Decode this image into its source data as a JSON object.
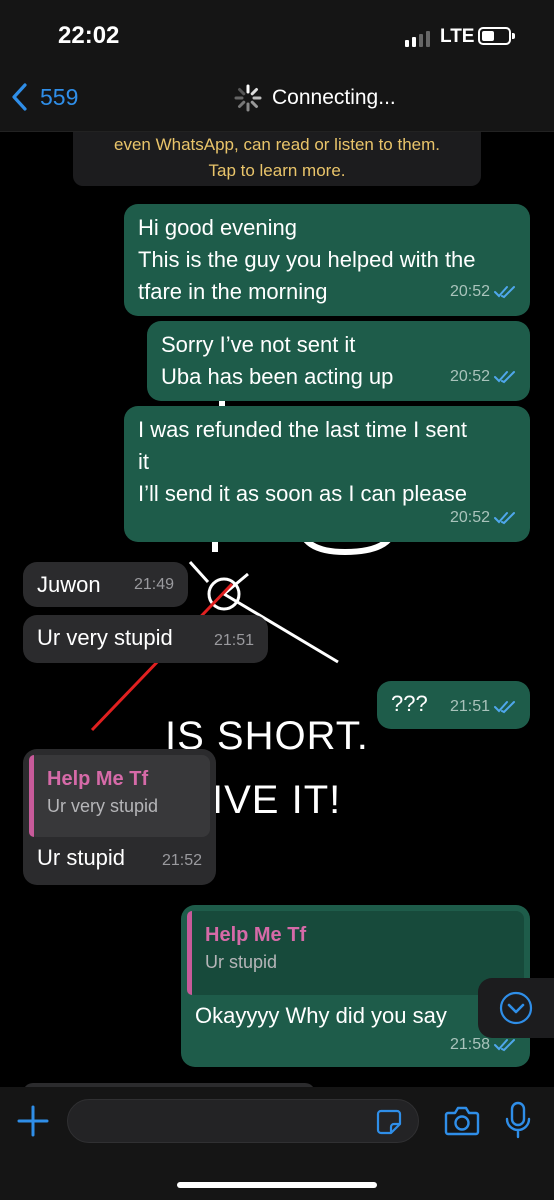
{
  "status_bar": {
    "time": "22:02",
    "network": "LTE"
  },
  "header": {
    "back_label": "559",
    "title": "Connecting..."
  },
  "encryption_notice": {
    "line1": "even WhatsApp, can read or listen to them.",
    "line2": "Tap to learn more."
  },
  "wallpaper_text": {
    "line1": "IS SHORT.",
    "line2": "IVE IT!",
    "top_fragment": "HO"
  },
  "messages": [
    {
      "direction": "out",
      "lines": [
        "Hi good evening",
        "This is the guy you helped with the",
        "tfare in the morning"
      ],
      "time": "20:52",
      "status": "read"
    },
    {
      "direction": "out",
      "lines": [
        "Sorry I’ve not sent it",
        "Uba has been acting up"
      ],
      "time": "20:52",
      "status": "read"
    },
    {
      "direction": "out",
      "lines": [
        "I was refunded the last time I sent",
        "it",
        "I’ll send it as soon as I can please"
      ],
      "time": "20:52",
      "status": "read"
    },
    {
      "direction": "in",
      "lines": [
        "Juwon"
      ],
      "time": "21:49"
    },
    {
      "direction": "in",
      "lines": [
        "Ur very stupid"
      ],
      "time": "21:51"
    },
    {
      "direction": "out",
      "lines": [
        "???"
      ],
      "time": "21:51",
      "status": "read"
    },
    {
      "direction": "in",
      "quote": {
        "name": "Help Me Tf",
        "text": "Ur very stupid"
      },
      "lines": [
        "Ur stupid"
      ],
      "time": "21:52"
    },
    {
      "direction": "out",
      "quote": {
        "name": "Help Me Tf",
        "text": "Ur stupid"
      },
      "lines": [
        "Okayyyy Why did you say"
      ],
      "time": "21:58",
      "status": "read"
    }
  ],
  "input": {
    "placeholder": ""
  },
  "colors": {
    "outgoing_bubble": "#1e5c4a",
    "incoming_bubble": "#2b2b2d",
    "accent_blue": "#2f8ee8",
    "quote_name": "#d66aa8",
    "notice_text": "#e9c46a"
  },
  "icons": {
    "back": "chevron-left-icon",
    "loading": "spinner-icon",
    "read_receipt": "double-check-icon",
    "scroll_down": "chevron-down-circle-icon",
    "attach": "plus-icon",
    "sticker": "sticker-icon",
    "camera": "camera-icon",
    "mic": "microphone-icon"
  }
}
